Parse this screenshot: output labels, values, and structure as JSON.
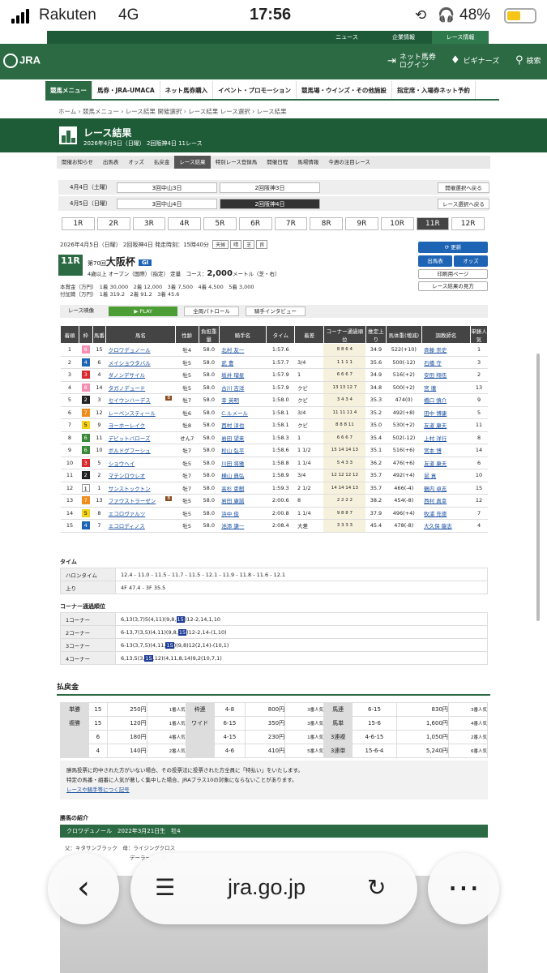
{
  "status": {
    "carrier": "Rakuten",
    "network": "4G",
    "time": "17:56",
    "battery": "48%"
  },
  "topbar": [
    "ニュース",
    "企業情報",
    "レース情報"
  ],
  "header": {
    "logo": "JRA",
    "net": "ネット馬券\nログイン",
    "beginners": "ビギナーズ",
    "search": "検索"
  },
  "mainnav": [
    "競馬メニュー",
    "馬券・JRA-UMACA",
    "ネット馬券購入",
    "イベント・プロモーション",
    "競馬場・ウインズ・その他施設",
    "指定席・入場券ネット予約"
  ],
  "breadcrumb": "ホーム › 競馬メニュー › レース結果 開催選択 › レース結果 レース選択 › レース結果",
  "title": {
    "main": "レース結果",
    "sub": "2026年4月5日（日曜） 2回阪神4日 11レース"
  },
  "subnav": [
    "開催お知らせ",
    "出馬表",
    "オッズ",
    "払戻金",
    "レース結果",
    "特別レース登録馬",
    "開催日程",
    "馬場情報",
    "今週の注目レース"
  ],
  "days": [
    {
      "date": "4月4日（土曜）",
      "m1": "3回中山3日",
      "m2": "2回阪神3日",
      "btn": "開催選択へ戻る"
    },
    {
      "date": "4月5日（日曜）",
      "m1": "3回中山4日",
      "m2": "2回阪神4日",
      "btn": "レース選択へ戻る"
    }
  ],
  "races": [
    "1R",
    "2R",
    "3R",
    "4R",
    "5R",
    "6R",
    "7R",
    "8R",
    "9R",
    "10R",
    "11R",
    "12R"
  ],
  "race": {
    "info": "2026年4月5日（日曜） 2回阪神4日 発走時刻：15時40分",
    "weather": [
      "天候",
      "晴",
      "芝",
      "良"
    ],
    "no": "11R",
    "kai": "第70回",
    "name": "大阪杯",
    "grade": "GⅠ",
    "cond": "4歳以上 オープン（国際）（指定） 定量",
    "course": "コース：",
    "dist": "2,000",
    "unit": "メートル（芝・右）",
    "prize1": "本賞金（万円）　1着 30,000　2着 12,000　3着 7,500　4着 4,500　5着 3,000",
    "prize2": "付加賞（万円）　1着 319.2　2着 91.2　3着 45.6"
  },
  "buttons": {
    "update": "更新",
    "card": "出馬表",
    "odds": "オッズ",
    "print": "印刷用ページ",
    "howto": "レース結果の見方"
  },
  "video": {
    "label": "レース映像",
    "play": "PLAY",
    "patrol": "全周パトロール",
    "interview": "騎手インタビュー"
  },
  "headers": [
    "着順",
    "枠",
    "馬番",
    "馬名",
    "性齢",
    "負担重量",
    "騎手名",
    "タイム",
    "着差",
    "コーナー通過順位",
    "推定上り",
    "馬体重(増減)",
    "調教師名",
    "単勝人気"
  ],
  "rows": [
    [
      "1",
      "8",
      "15",
      "クロワデュノール",
      "牡4",
      "58.0",
      "北村 友一",
      "1:57.6",
      "",
      "8 8 6 4",
      "34.9",
      "522(+10)",
      "斉藤 崇史",
      "1"
    ],
    [
      "2",
      "4",
      "6",
      "メイショウタバル",
      "牡5",
      "58.0",
      "武 豊",
      "1:57.7",
      "3/4",
      "1 1 1 1",
      "35.6",
      "500(-12)",
      "石橋 守",
      "3"
    ],
    [
      "3",
      "3",
      "4",
      "ダノンデサイル",
      "牡5",
      "58.0",
      "坂井 瑠星",
      "1:57.9",
      "1",
      "6 6 6 7",
      "34.9",
      "516(+2)",
      "安田 翔伍",
      "2"
    ],
    [
      "4",
      "8",
      "14",
      "タガノデュード",
      "牡5",
      "58.0",
      "古川 吉洋",
      "1:57.9",
      "クビ",
      "13 13 12 7",
      "34.8",
      "500(+2)",
      "宮 徹",
      "13"
    ],
    [
      "5",
      "2",
      "3",
      "セイウンハーデス",
      "牡7",
      "58.0",
      "幸 英明",
      "1:58.0",
      "クビ",
      "3 4 3 4",
      "35.3",
      "474(0)",
      "橋口 慎介",
      "9"
    ],
    [
      "6",
      "7",
      "12",
      "レーベンスティール",
      "牡6",
      "58.0",
      "C.ルメール",
      "1:58.1",
      "3/4",
      "11 11 11 4",
      "35.2",
      "492(+8)",
      "田中 博康",
      "5"
    ],
    [
      "7",
      "5",
      "9",
      "ヨーホーレイク",
      "牡8",
      "58.0",
      "西村 淳也",
      "1:58.1",
      "クビ",
      "8 8 8 11",
      "35.0",
      "530(+2)",
      "友道 康夫",
      "11"
    ],
    [
      "8",
      "6",
      "11",
      "デビットバローズ",
      "せん7",
      "58.0",
      "岩田 望来",
      "1:58.3",
      "1",
      "6 6 6 7",
      "35.4",
      "502(-12)",
      "上村 洋行",
      "8"
    ],
    [
      "9",
      "6",
      "10",
      "ボルドグフーシュ",
      "牡7",
      "58.0",
      "松山 弘平",
      "1:58.6",
      "1 1/2",
      "15 14 14 13",
      "35.1",
      "516(+6)",
      "宮本 博",
      "14"
    ],
    [
      "10",
      "3",
      "5",
      "ショウヘイ",
      "牡5",
      "58.0",
      "川田 将雅",
      "1:58.8",
      "1 1/4",
      "5 4 3 3",
      "36.2",
      "476(+6)",
      "友道 康夫",
      "6"
    ],
    [
      "11",
      "2",
      "2",
      "マテンロウレオ",
      "牡7",
      "58.0",
      "横山 典弘",
      "1:58.9",
      "3/4",
      "12 12 12 12",
      "35.7",
      "492(+4)",
      "昆 貢",
      "10"
    ],
    [
      "12",
      "1",
      "1",
      "サンストックトン",
      "牡7",
      "58.0",
      "高杉 吏麒",
      "1:59.3",
      "2 1/2",
      "14 14 14 13",
      "35.7",
      "466(-4)",
      "鶴内 卓志",
      "15"
    ],
    [
      "13",
      "7",
      "13",
      "ファウストラーゼン",
      "牡5",
      "58.0",
      "岩田 康誠",
      "2:00.6",
      "8",
      "2 2 2 2",
      "38.2",
      "454(-8)",
      "西村 真幸",
      "12"
    ],
    [
      "14",
      "5",
      "8",
      "エコロヴァルツ",
      "牡5",
      "58.0",
      "浜中 俊",
      "2:00.8",
      "1 1/4",
      "9 8 8 7",
      "37.9",
      "496(+4)",
      "牧浦 充徳",
      "7"
    ],
    [
      "15",
      "4",
      "7",
      "エコロディノス",
      "牡5",
      "58.0",
      "池添 謙一",
      "2:08.4",
      "大差",
      "3 3 3 3",
      "45.4",
      "478(-8)",
      "大久保 龍志",
      "4"
    ]
  ],
  "blinker": [
    "セイウンハーデス",
    "ファウストラーゼン"
  ],
  "time": {
    "title": "タイム",
    "lap_label": "ハロンタイム",
    "laps": "12.4 - 11.0 - 11.5 - 11.7 - 11.5 - 12.1 - 11.9 - 11.8 - 11.6 - 12.1",
    "agari_label": "上り",
    "agari": "4F 47.4 - 3F 35.5"
  },
  "corners": {
    "title": "コーナー通過順位",
    "rows": [
      {
        "label": "1コーナー",
        "pre": "6,13(3,7)5(4,11)(9,8,",
        "hl": "15",
        "post": ")12-2,14,1,10"
      },
      {
        "label": "2コーナー",
        "pre": "6-13,7(3,5)(4,11)(9,8,",
        "hl": "15",
        "post": ")12-2,14-(1,10)"
      },
      {
        "label": "3コーナー",
        "pre": "6-13(3,7,5)(4,11,",
        "hl": "15",
        "post": ")(9,8)12(2,14)-(10,1)"
      },
      {
        "label": "4コーナー",
        "pre": "6,13,5(3,",
        "hl": "15",
        "post": ",12)(4,11,8,14)9,2(10,7,1)"
      }
    ]
  },
  "payout": {
    "title": "払戻金",
    "rows": [
      [
        "単勝",
        "15",
        "250円",
        "1番人気",
        "枠連",
        "4-8",
        "800円",
        "3番人気",
        "馬連",
        "6-15",
        "830円",
        "3番人気"
      ],
      [
        "複勝",
        "15",
        "120円",
        "1番人気",
        "ワイド",
        "6-15",
        "350円",
        "3番人気",
        "馬単",
        "15-6",
        "1,600円",
        "4番人気"
      ],
      [
        "",
        "6",
        "180円",
        "4番人気",
        "",
        "4-15",
        "230円",
        "1番人気",
        "3連複",
        "4-6-15",
        "1,050円",
        "2番人気"
      ],
      [
        "",
        "4",
        "140円",
        "2番人気",
        "",
        "4-6",
        "410円",
        "5番人気",
        "3連単",
        "15-6-4",
        "5,240円",
        "6番人気"
      ]
    ]
  },
  "notes": [
    "勝馬投票に的中された方がいない場合、その投票法に投票された方全員に「特払い」をいたします。",
    "特定の馬番・組番に人気が著しく集中した場合、JRAプラス10の対象にならないことがあります。",
    "レースや騎手等につく記号"
  ],
  "horse": {
    "title": "勝馬の紹介",
    "name": "クロワデュノール",
    "born": "2022年3月21日生",
    "sex": "牡4",
    "sire": "父：キタサンブラック",
    "dam": "母：ライジングクロス",
    "bms": "デーラーシング"
  },
  "browser": {
    "url": "jra.go.jp"
  },
  "colors": {
    "green": "#2b6a43",
    "waku": [
      "#ffffff",
      "#ffffff",
      "#222222",
      "#d8292f",
      "#1e64b4",
      "#f3d21b",
      "#3a8a3a",
      "#f08b1d",
      "#f48fb1"
    ]
  }
}
